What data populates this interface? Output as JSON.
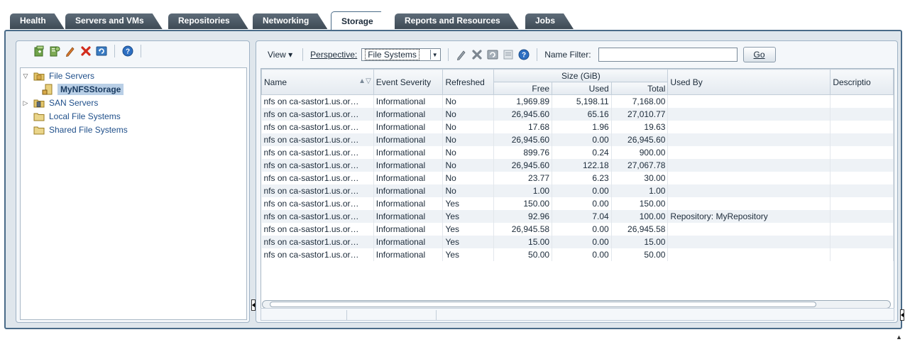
{
  "tabs": [
    {
      "label": "Health"
    },
    {
      "label": "Servers and VMs"
    },
    {
      "label": "Repositories"
    },
    {
      "label": "Networking"
    },
    {
      "label": "Storage"
    },
    {
      "label": "Reports and Resources"
    },
    {
      "label": "Jobs"
    }
  ],
  "active_tab": "Storage",
  "left_toolbar_icons": [
    "add-file-server-icon",
    "discover-server-icon",
    "edit-icon",
    "delete-icon",
    "refresh-icon",
    "help-icon"
  ],
  "tree": {
    "items": [
      {
        "label": "File Servers",
        "expanded": true
      },
      {
        "label": "MyNFSStorage",
        "selected": true
      },
      {
        "label": "SAN Servers",
        "expanded": false
      },
      {
        "label": "Local File Systems"
      },
      {
        "label": "Shared File Systems"
      }
    ]
  },
  "toolbar": {
    "view_label": "View",
    "perspective_label": "Perspective:",
    "perspective_value": "File Systems",
    "name_filter_label": "Name Filter:",
    "name_filter_value": "",
    "go_label": "Go",
    "icons": [
      "edit-icon",
      "delete-icon",
      "refresh-icon",
      "properties-icon",
      "help-icon"
    ]
  },
  "table": {
    "headers": {
      "name": "Name",
      "event_severity": "Event Severity",
      "refreshed": "Refreshed",
      "size_group": "Size (GiB)",
      "free": "Free",
      "used": "Used",
      "total": "Total",
      "used_by": "Used By",
      "description": "Descriptio"
    },
    "rows": [
      {
        "name": "nfs on ca-sastor1.us.or…",
        "severity": "Informational",
        "refreshed": "No",
        "free": "1,969.89",
        "used": "5,198.11",
        "total": "7,168.00",
        "used_by": ""
      },
      {
        "name": "nfs on ca-sastor1.us.or…",
        "severity": "Informational",
        "refreshed": "No",
        "free": "26,945.60",
        "used": "65.16",
        "total": "27,010.77",
        "used_by": ""
      },
      {
        "name": "nfs on ca-sastor1.us.or…",
        "severity": "Informational",
        "refreshed": "No",
        "free": "17.68",
        "used": "1.96",
        "total": "19.63",
        "used_by": ""
      },
      {
        "name": "nfs on ca-sastor1.us.or…",
        "severity": "Informational",
        "refreshed": "No",
        "free": "26,945.60",
        "used": "0.00",
        "total": "26,945.60",
        "used_by": ""
      },
      {
        "name": "nfs on ca-sastor1.us.or…",
        "severity": "Informational",
        "refreshed": "No",
        "free": "899.76",
        "used": "0.24",
        "total": "900.00",
        "used_by": ""
      },
      {
        "name": "nfs on ca-sastor1.us.or…",
        "severity": "Informational",
        "refreshed": "No",
        "free": "26,945.60",
        "used": "122.18",
        "total": "27,067.78",
        "used_by": ""
      },
      {
        "name": "nfs on ca-sastor1.us.or…",
        "severity": "Informational",
        "refreshed": "No",
        "free": "23.77",
        "used": "6.23",
        "total": "30.00",
        "used_by": ""
      },
      {
        "name": "nfs on ca-sastor1.us.or…",
        "severity": "Informational",
        "refreshed": "No",
        "free": "1.00",
        "used": "0.00",
        "total": "1.00",
        "used_by": ""
      },
      {
        "name": "nfs on ca-sastor1.us.or…",
        "severity": "Informational",
        "refreshed": "Yes",
        "free": "150.00",
        "used": "0.00",
        "total": "150.00",
        "used_by": ""
      },
      {
        "name": "nfs on ca-sastor1.us.or…",
        "severity": "Informational",
        "refreshed": "Yes",
        "free": "92.96",
        "used": "7.04",
        "total": "100.00",
        "used_by": "Repository: MyRepository"
      },
      {
        "name": "nfs on ca-sastor1.us.or…",
        "severity": "Informational",
        "refreshed": "Yes",
        "free": "26,945.58",
        "used": "0.00",
        "total": "26,945.58",
        "used_by": ""
      },
      {
        "name": "nfs on ca-sastor1.us.or…",
        "severity": "Informational",
        "refreshed": "Yes",
        "free": "15.00",
        "used": "0.00",
        "total": "15.00",
        "used_by": ""
      },
      {
        "name": "nfs on ca-sastor1.us.or…",
        "severity": "Informational",
        "refreshed": "Yes",
        "free": "50.00",
        "used": "0.00",
        "total": "50.00",
        "used_by": ""
      }
    ]
  },
  "colors": {
    "tab_dark": "#3e4a55",
    "frame_border": "#4a6b88",
    "link_blue": "#1f4f8a",
    "selection": "#b9cfe6"
  }
}
